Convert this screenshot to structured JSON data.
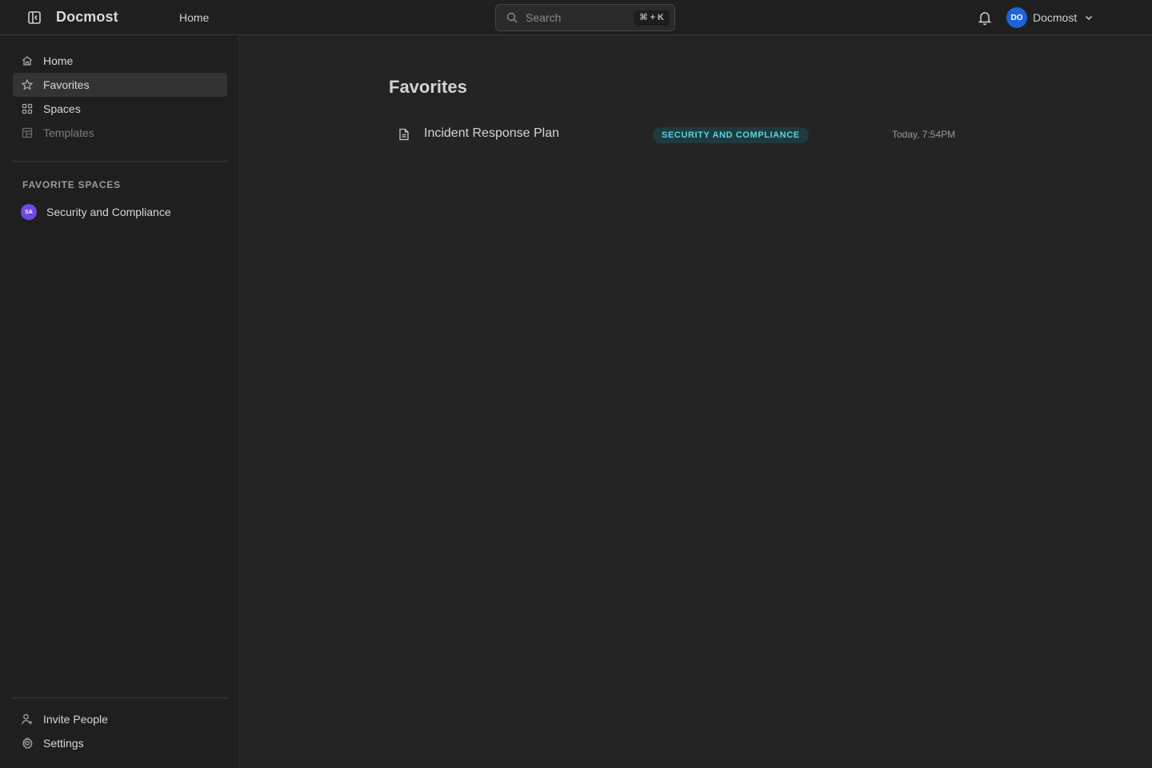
{
  "header": {
    "brand": "Docmost",
    "home_link": "Home",
    "search_placeholder": "Search",
    "search_shortcut": "⌘ + K",
    "user": {
      "initials": "DO",
      "name": "Docmost"
    }
  },
  "sidebar": {
    "nav": [
      {
        "label": "Home",
        "icon": "home-icon"
      },
      {
        "label": "Favorites",
        "icon": "star-icon",
        "active": true
      },
      {
        "label": "Spaces",
        "icon": "grid-icon"
      },
      {
        "label": "Templates",
        "icon": "template-icon",
        "disabled": true
      }
    ],
    "favorite_spaces_label": "FAVORITE SPACES",
    "favorite_spaces": [
      {
        "initials": "SA",
        "name": "Security and Compliance"
      }
    ],
    "footer": [
      {
        "label": "Invite People",
        "icon": "user-plus-icon"
      },
      {
        "label": "Settings",
        "icon": "gear-icon"
      }
    ]
  },
  "main": {
    "title": "Favorites",
    "favorites": [
      {
        "title": "Incident Response Plan",
        "space": "SECURITY AND COMPLIANCE",
        "date": "Today, 7:54PM"
      }
    ]
  },
  "colors": {
    "background": "#242424",
    "sidebar": "#1f1f1f",
    "accent_badge_bg": "#1f3a3e",
    "accent_badge_text": "#5bd3e3",
    "user_avatar": "#1c64d8",
    "space_avatar": "#7048e8"
  }
}
